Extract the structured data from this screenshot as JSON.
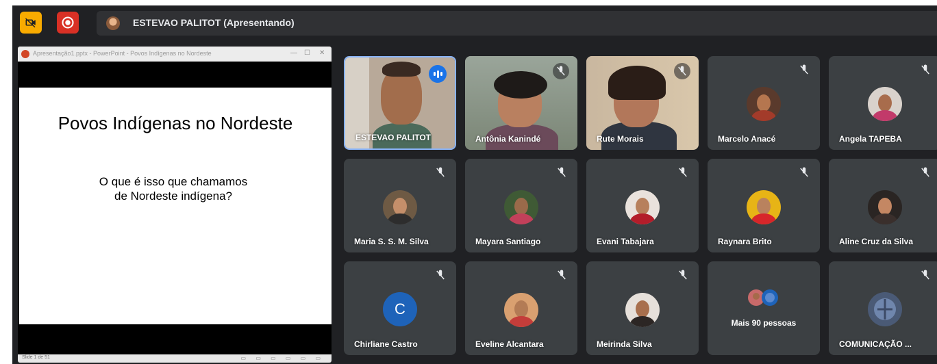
{
  "topbar": {
    "camera_icon": "camera-off-icon",
    "record_icon": "record-icon",
    "presenter_label": "ESTEVAO PALITOT (Apresentando)",
    "camera_button_color": "#f9ab00",
    "record_button_color": "#d93025"
  },
  "presentation": {
    "window_title": "Apresentação1.pptx - PowerPoint - Povos Indígenas no Nordeste",
    "window_controls": [
      "—",
      "☐",
      "✕"
    ],
    "slide_title": "Povos Indígenas no Nordeste",
    "slide_body_line1": "O que é isso que chamamos",
    "slide_body_line2": "de Nordeste indígena?",
    "status_text": "Slide 1 de 51",
    "view_icons": "▭ ▭ ▭ ▭ ▭ ▭"
  },
  "participants": [
    {
      "name": "ESTEVAO PALITOT",
      "kind": "video",
      "speaking": true
    },
    {
      "name": "Antônia Kanindé",
      "kind": "video",
      "muted": true
    },
    {
      "name": "Rute Morais",
      "kind": "video",
      "muted": true
    },
    {
      "name": "Marcelo Anacé",
      "kind": "avatar",
      "muted": true
    },
    {
      "name": "Angela TAPEBA",
      "kind": "avatar",
      "muted": true
    },
    {
      "name": "Maria S. S. M. Silva",
      "kind": "avatar",
      "muted": true
    },
    {
      "name": "Mayara Santiago",
      "kind": "avatar",
      "muted": true
    },
    {
      "name": "Evani Tabajara",
      "kind": "avatar",
      "muted": true
    },
    {
      "name": "Raynara Brito",
      "kind": "avatar",
      "muted": true
    },
    {
      "name": "Aline Cruz da Silva",
      "kind": "avatar",
      "muted": true
    },
    {
      "name": "Chirliane Castro",
      "kind": "letter",
      "letter": "C",
      "muted": true
    },
    {
      "name": "Eveline Alcantara",
      "kind": "avatar",
      "muted": true
    },
    {
      "name": "Meirinda Silva",
      "kind": "avatar",
      "muted": true
    },
    {
      "name": "",
      "kind": "more",
      "more_label": "Mais 90 pessoas"
    },
    {
      "name": "COMUNICAÇÃO ...",
      "kind": "avatar-blue",
      "muted": true
    }
  ],
  "colors": {
    "background": "#202124",
    "tile": "#3c4043",
    "active_border": "#8ab4f8",
    "speaking_indicator": "#1a73e8",
    "letter_avatar": "#1e63b9"
  },
  "icons": {
    "mute": "mic-off-icon",
    "speaking": "audio-level-icon"
  }
}
